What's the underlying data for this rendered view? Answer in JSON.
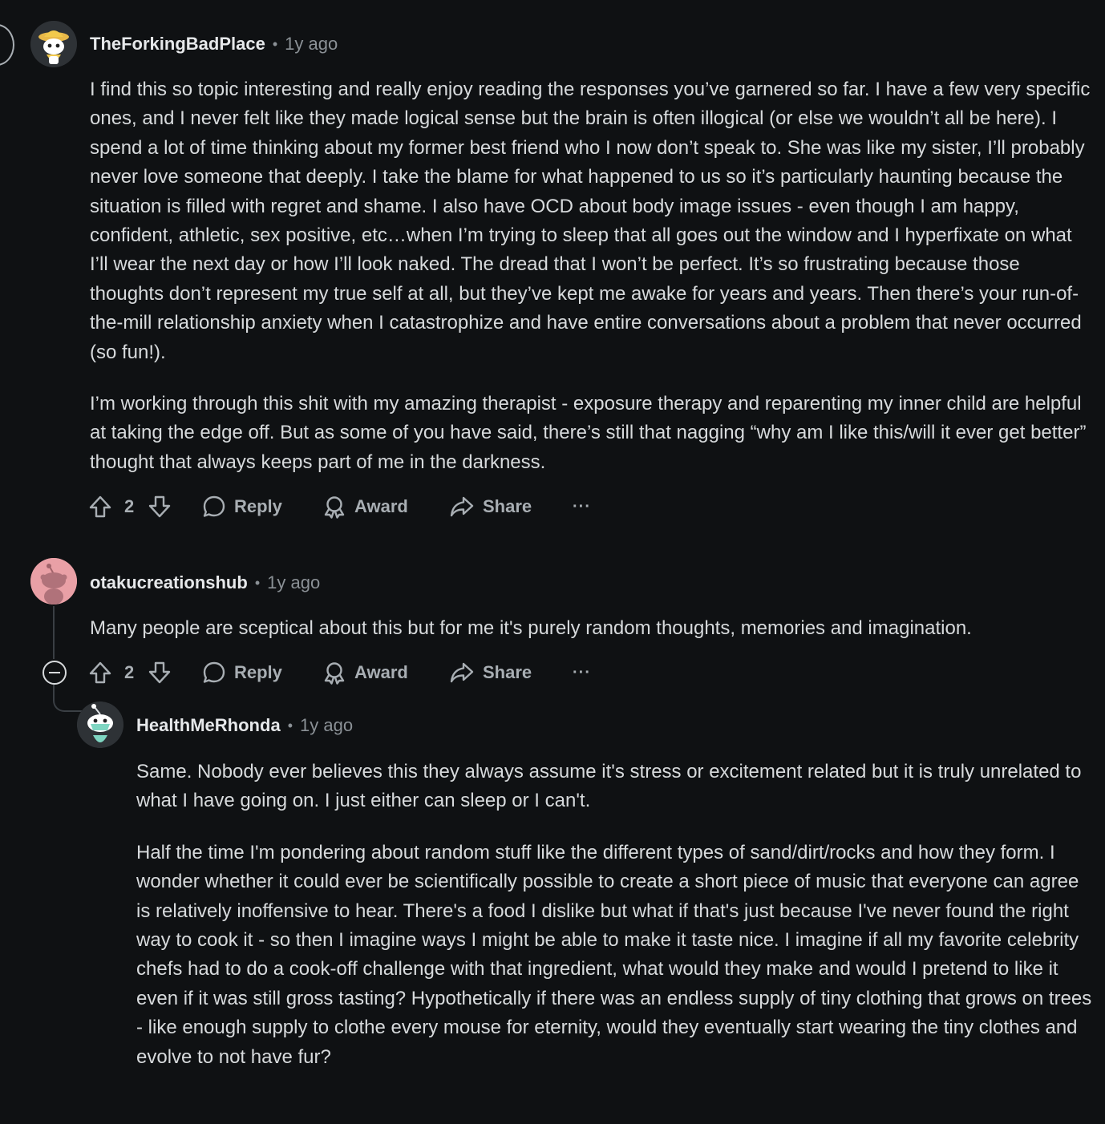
{
  "comments": [
    {
      "username": "TheForkingBadPlace",
      "separator": "•",
      "time": "1y ago",
      "avatar_icon": "snoo-avatar-hat-icon",
      "paragraphs": [
        "I find this so topic interesting and really enjoy reading the responses you’ve garnered so far. I have a few very specific ones, and I never felt like they made logical sense but the brain is often illogical (or else we wouldn’t all be here). I spend a lot of time thinking about my former best friend who I now don’t speak to. She was like my sister, I’ll probably never love someone that deeply. I take the blame for what happened to us so it’s particularly haunting because the situation is filled with regret and shame. I also have OCD about body image issues - even though I am happy, confident, athletic, sex positive, etc…when I’m trying to sleep that all goes out the window and I hyperfixate on what I’ll wear the next day or how I’ll look naked. The dread that I won’t be perfect. It’s so frustrating because those thoughts don’t represent my true self at all, but they’ve kept me awake for years and years. Then there’s your run-of-the-mill relationship anxiety when I catastrophize and have entire conversations about a problem that never occurred (so fun!).",
        "I’m working through this shit with my amazing therapist - exposure therapy and reparenting my inner child are helpful at taking the edge off. But as some of you have said, there’s still that nagging “why am I like this/will it ever get better” thought that always keeps part of me in the darkness."
      ],
      "votes": "2",
      "actions": {
        "reply": "Reply",
        "award": "Award",
        "share": "Share",
        "more": "···"
      }
    },
    {
      "username": "otakucreationshub",
      "separator": "•",
      "time": "1y ago",
      "avatar_icon": "snoo-default-avatar-icon",
      "paragraphs": [
        "Many people are sceptical about this but for me it's purely random thoughts, memories and imagination."
      ],
      "votes": "2",
      "actions": {
        "reply": "Reply",
        "award": "Award",
        "share": "Share",
        "more": "···"
      }
    },
    {
      "username": "HealthMeRhonda",
      "separator": "•",
      "time": "1y ago",
      "avatar_icon": "snoo-mask-avatar-icon",
      "paragraphs": [
        "Same. Nobody ever believes this they always assume it's stress or excitement related but it is truly unrelated to what I have going on. I just either can sleep or I can't.",
        "Half the time I'm pondering about random stuff like the different types of sand/dirt/rocks and how they form. I wonder whether it could ever be scientifically possible to create a short piece of music that everyone can agree is relatively inoffensive to hear. There's a food I dislike but what if that's  just because I've never found the right way to cook it - so then I imagine ways I might be able to make it taste nice. I imagine if all my favorite celebrity chefs had to do a cook-off challenge with that ingredient, what would they make and would I pretend to like it even if it was still gross tasting? Hypothetically if there was an endless supply of tiny clothing that grows on trees - like enough supply to clothe every mouse for eternity, would they eventually start wearing the tiny clothes and evolve to not have fur?"
      ]
    }
  ],
  "colors": {
    "background": "#0f1113",
    "text": "#d7dadc",
    "muted": "#8b9196",
    "action": "#a8aeb3"
  }
}
